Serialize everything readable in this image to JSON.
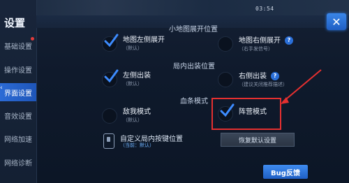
{
  "status_bar": {
    "clock": "03:54"
  },
  "sidebar": {
    "title": "设置",
    "items": [
      {
        "label": "基础设置",
        "active": false,
        "has_badge": true
      },
      {
        "label": "操作设置",
        "active": false
      },
      {
        "label": "界面设置",
        "active": true
      },
      {
        "label": "音效设置",
        "active": false
      },
      {
        "label": "网络加速",
        "active": false
      },
      {
        "label": "网络诊断",
        "active": false
      }
    ]
  },
  "sections": {
    "minimap": {
      "title": "小地图展开位置"
    },
    "equip": {
      "title": "局内出装位置"
    },
    "health": {
      "title": "血条模式"
    }
  },
  "options": {
    "minimap_left": {
      "label": "地图左侧展开",
      "sub": "（默认）",
      "checked": true
    },
    "minimap_right": {
      "label": "地图右侧展开",
      "sub": "（右手发信号）",
      "checked": false
    },
    "equip_left": {
      "label": "左侧出装",
      "sub": "（默认）",
      "checked": true
    },
    "equip_right": {
      "label": "右侧出装",
      "sub": "（建议关闭推荐描述）",
      "checked": false
    },
    "enemy_mode": {
      "label": "敌我模式",
      "sub": "（默认）",
      "checked": false
    },
    "camp_mode": {
      "label": "阵营模式",
      "sub": "",
      "checked": true
    }
  },
  "custom_layout": {
    "label": "自定义局内按键位置",
    "current_prefix": "（当前：",
    "current_value": "默认",
    "current_suffix": "）"
  },
  "buttons": {
    "restore": "恢复默认设置",
    "bug": "Bug反馈",
    "close": "✕"
  },
  "colors": {
    "accent": "#2c6bd6",
    "highlight": "#e53030"
  }
}
